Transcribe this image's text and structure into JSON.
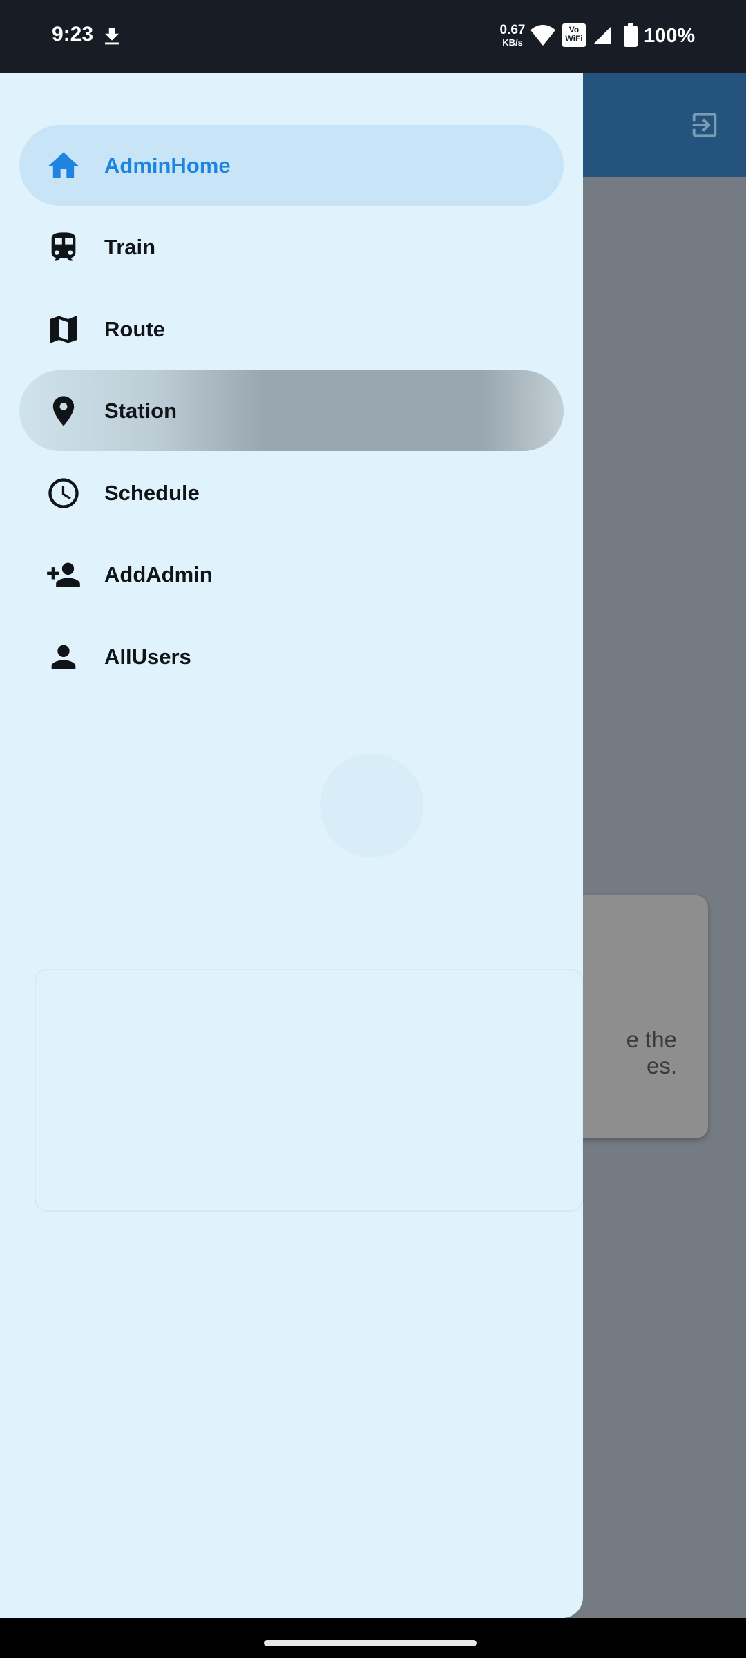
{
  "status_bar": {
    "time": "9:23",
    "download_icon": "download-icon",
    "net_speed_value": "0.67",
    "net_speed_unit": "KB/s",
    "vowifi_line1": "Vo",
    "vowifi_line2": "WiFi",
    "battery_percent": "100%"
  },
  "drawer": {
    "items": [
      {
        "label": "AdminHome",
        "icon": "home-icon",
        "state": "selected"
      },
      {
        "label": "Train",
        "icon": "train-icon"
      },
      {
        "label": "Route",
        "icon": "map-icon"
      },
      {
        "label": "Station",
        "icon": "location-pin-icon",
        "state": "pressed"
      },
      {
        "label": "Schedule",
        "icon": "clock-icon"
      },
      {
        "label": "AddAdmin",
        "icon": "add-person-icon"
      },
      {
        "label": "AllUsers",
        "icon": "person-icon"
      }
    ]
  },
  "background_screen": {
    "card_text": "e the es.",
    "logout_icon": "logout-icon"
  },
  "colors": {
    "drawer_bg": "#e0f3fc",
    "selected_bg": "#c8e5f7",
    "selected_text": "#1f84df",
    "appbar": "#24547e",
    "scrim": "#757b82"
  }
}
